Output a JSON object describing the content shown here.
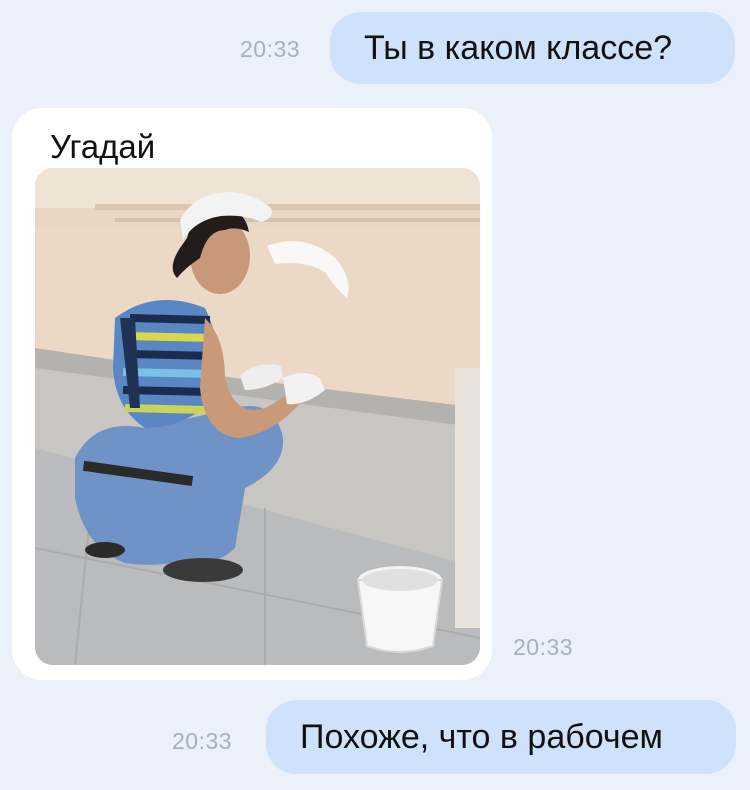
{
  "messages": [
    {
      "direction": "outgoing",
      "text": "Ты в каком классе?",
      "time": "20:33"
    },
    {
      "direction": "incoming",
      "text": "Угадай",
      "time": "20:33",
      "attachment": "photo"
    },
    {
      "direction": "outgoing",
      "text": "Похоже, что в рабочем",
      "time": "20:33"
    }
  ],
  "colors": {
    "background": "#eaf1fb",
    "outgoing_bubble": "#cfe2fb",
    "incoming_bubble": "#ffffff",
    "timestamp": "#a8b0bd"
  }
}
